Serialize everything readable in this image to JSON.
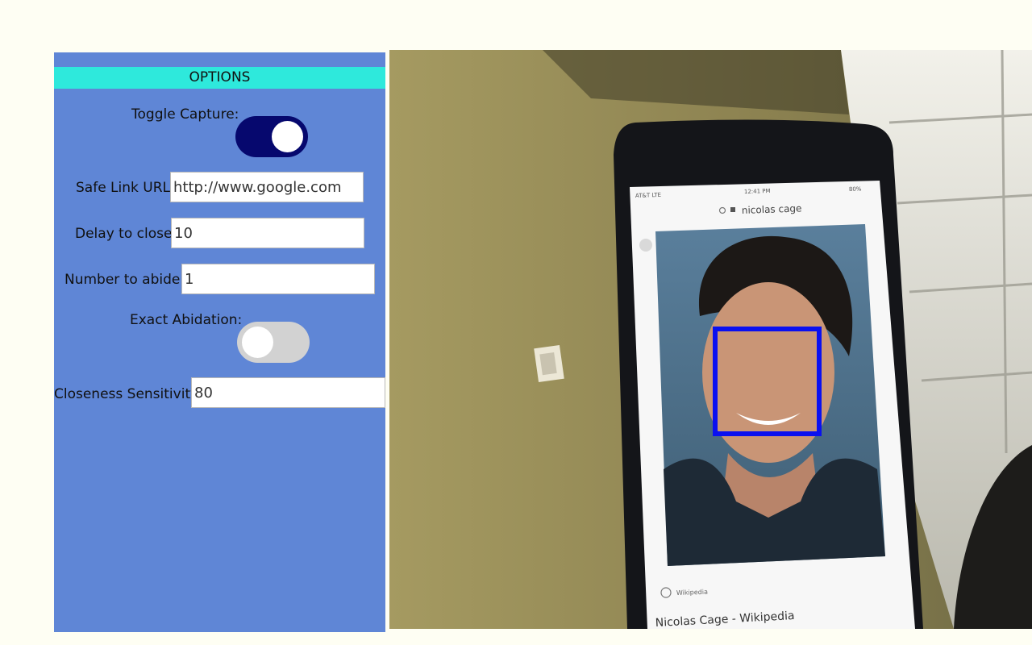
{
  "options": {
    "title": "OPTIONS",
    "toggle_capture": {
      "label": "Toggle Capture:",
      "on": true
    },
    "safe_link_url": {
      "label": "Safe Link URL:",
      "value": "http://www.google.com"
    },
    "delay_to_close": {
      "label": "Delay to close:",
      "value": "10"
    },
    "number_to_abide": {
      "label": "Number to abide:",
      "value": "1"
    },
    "exact_abidation": {
      "label": "Exact Abidation:",
      "on": false
    },
    "closeness_sensitivity": {
      "label": "Closeness Sensitivity:",
      "value": "80"
    }
  },
  "camera": {
    "phone_screen": {
      "carrier": "AT&T LTE",
      "time": "12:41 PM",
      "battery": "80%",
      "search_query": "nicolas cage",
      "source": "Wikipedia",
      "result_title": "Nicolas Cage - Wikipedia"
    },
    "detection_color": "#0a10f0"
  },
  "colors": {
    "panel_bg": "#5f86d6",
    "header_bg": "#2ee9dc",
    "toggle_on": "#06086e",
    "toggle_off": "#d2d2d2",
    "page_bg": "#fefef3"
  }
}
